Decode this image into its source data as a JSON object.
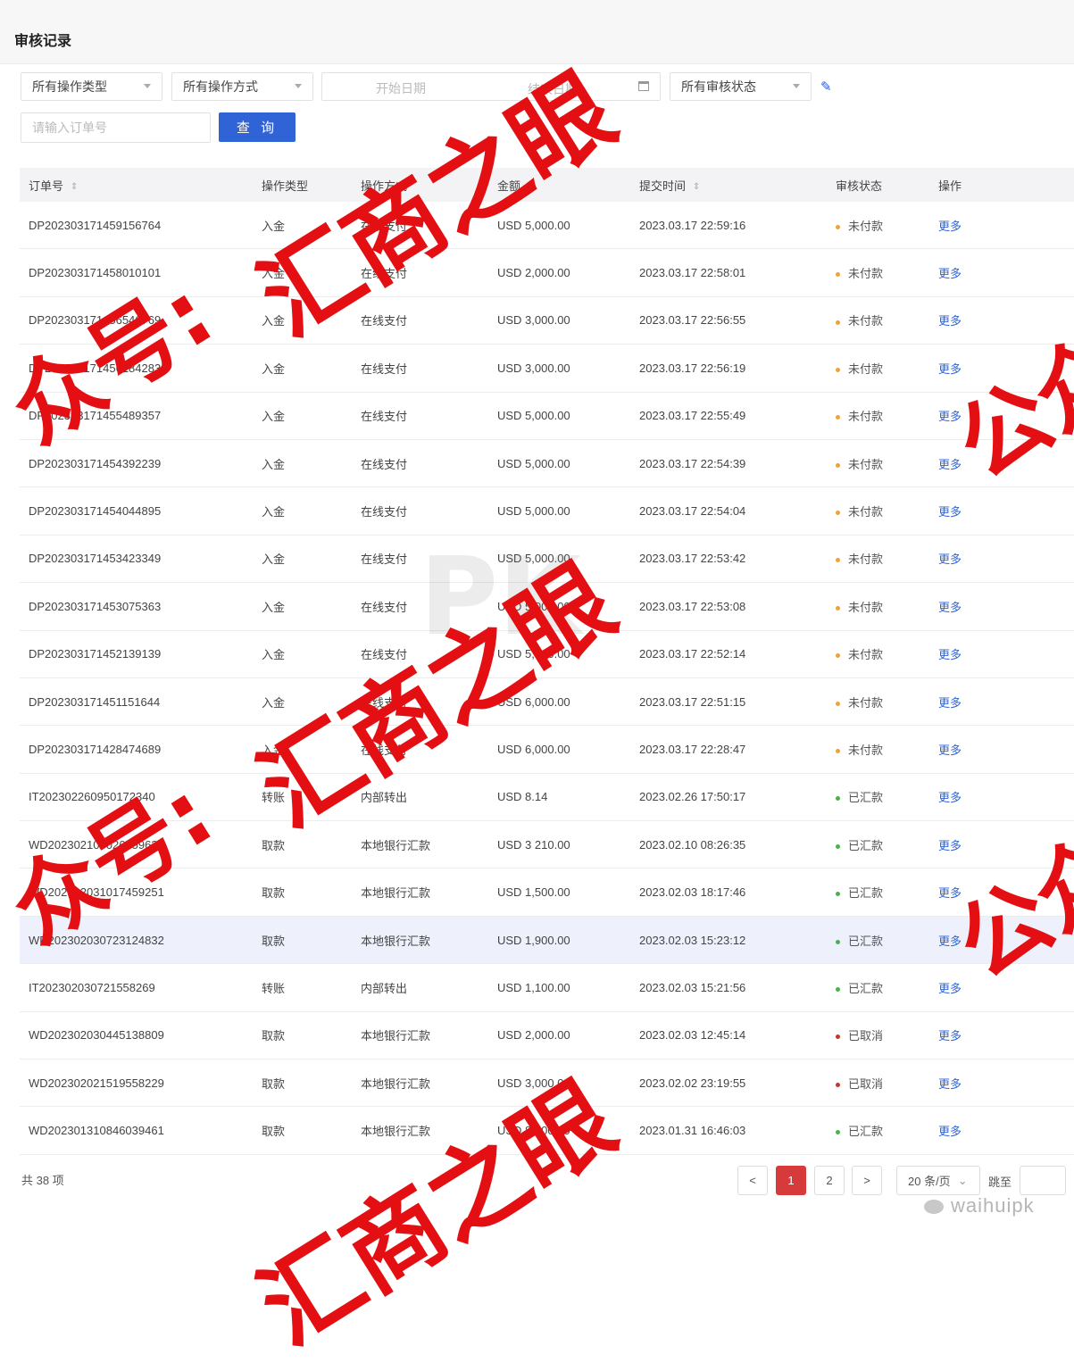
{
  "page": {
    "title": "审核记录"
  },
  "filters": {
    "op_type": "所有操作类型",
    "op_method": "所有操作方式",
    "start_date": "开始日期",
    "end_date": "结束日期",
    "status": "所有审核状态",
    "order_placeholder": "请输入订单号",
    "query_label": "查 询"
  },
  "table": {
    "headers": [
      "订单号",
      "操作类型",
      "操作方式",
      "金额",
      "提交时间",
      "审核状态",
      "操作"
    ],
    "rows": [
      {
        "order": "DP202303171459156764",
        "type": "入金",
        "method": "在线支付",
        "amount": "USD 5,000.00",
        "time": "2023.03.17 22:59:16",
        "status": "未付款",
        "action": "更多"
      },
      {
        "order": "DP202303171458010101",
        "type": "入金",
        "method": "在线支付",
        "amount": "USD 2,000.00",
        "time": "2023.03.17 22:58:01",
        "status": "未付款",
        "action": "更多"
      },
      {
        "order": "DP202303171456546769",
        "type": "入金",
        "method": "在线支付",
        "amount": "USD 3,000.00",
        "time": "2023.03.17 22:56:55",
        "status": "未付款",
        "action": "更多"
      },
      {
        "order": "DP202303171456184283",
        "type": "入金",
        "method": "在线支付",
        "amount": "USD 3,000.00",
        "time": "2023.03.17 22:56:19",
        "status": "未付款",
        "action": "更多"
      },
      {
        "order": "DP202303171455489357",
        "type": "入金",
        "method": "在线支付",
        "amount": "USD 5,000.00",
        "time": "2023.03.17 22:55:49",
        "status": "未付款",
        "action": "更多"
      },
      {
        "order": "DP202303171454392239",
        "type": "入金",
        "method": "在线支付",
        "amount": "USD 5,000.00",
        "time": "2023.03.17 22:54:39",
        "status": "未付款",
        "action": "更多"
      },
      {
        "order": "DP202303171454044895",
        "type": "入金",
        "method": "在线支付",
        "amount": "USD 5,000.00",
        "time": "2023.03.17 22:54:04",
        "status": "未付款",
        "action": "更多"
      },
      {
        "order": "DP202303171453423349",
        "type": "入金",
        "method": "在线支付",
        "amount": "USD 5,000.00",
        "time": "2023.03.17 22:53:42",
        "status": "未付款",
        "action": "更多"
      },
      {
        "order": "DP202303171453075363",
        "type": "入金",
        "method": "在线支付",
        "amount": "USD 5,000.00",
        "time": "2023.03.17 22:53:08",
        "status": "未付款",
        "action": "更多"
      },
      {
        "order": "DP202303171452139139",
        "type": "入金",
        "method": "在线支付",
        "amount": "USD 5,000.00",
        "time": "2023.03.17 22:52:14",
        "status": "未付款",
        "action": "更多"
      },
      {
        "order": "DP202303171451151644",
        "type": "入金",
        "method": "在线支付",
        "amount": "USD 6,000.00",
        "time": "2023.03.17 22:51:15",
        "status": "未付款",
        "action": "更多"
      },
      {
        "order": "DP202303171428474689",
        "type": "入金",
        "method": "在线支付",
        "amount": "USD 6,000.00",
        "time": "2023.03.17 22:28:47",
        "status": "未付款",
        "action": "更多"
      },
      {
        "order": "IT202302260950172340",
        "type": "转账",
        "method": "内部转出",
        "amount": "USD 8.14",
        "time": "2023.02.26 17:50:17",
        "status": "已汇款",
        "action": "更多"
      },
      {
        "order": "WD202302100026359635",
        "type": "取款",
        "method": "本地银行汇款",
        "amount": "USD 3 210.00",
        "time": "2023.02.10 08:26:35",
        "status": "已汇款",
        "action": "更多"
      },
      {
        "order": "WD202302031017459251",
        "type": "取款",
        "method": "本地银行汇款",
        "amount": "USD 1,500.00",
        "time": "2023.02.03 18:17:46",
        "status": "已汇款",
        "action": "更多"
      },
      {
        "order": "WD202302030723124832",
        "type": "取款",
        "method": "本地银行汇款",
        "amount": "USD 1,900.00",
        "time": "2023.02.03 15:23:12",
        "status": "已汇款",
        "action": "更多"
      },
      {
        "order": "IT202302030721558269",
        "type": "转账",
        "method": "内部转出",
        "amount": "USD 1,100.00",
        "time": "2023.02.03 15:21:56",
        "status": "已汇款",
        "action": "更多"
      },
      {
        "order": "WD202302030445138809",
        "type": "取款",
        "method": "本地银行汇款",
        "amount": "USD 2,000.00",
        "time": "2023.02.03 12:45:14",
        "status": "已取消",
        "action": "更多"
      },
      {
        "order": "WD202302021519558229",
        "type": "取款",
        "method": "本地银行汇款",
        "amount": "USD 3,000.00",
        "time": "2023.02.02 23:19:55",
        "status": "已取消",
        "action": "更多"
      },
      {
        "order": "WD202301310846039461",
        "type": "取款",
        "method": "本地银行汇款",
        "amount": "USD 8,000.00",
        "time": "2023.01.31 16:46:03",
        "status": "已汇款",
        "action": "更多"
      }
    ]
  },
  "status_colors": {
    "未付款": "#f0a23a",
    "已汇款": "#4caf50",
    "已取消": "#c0392b"
  },
  "pagination": {
    "total": "共 38 项",
    "prev": "<",
    "pages": [
      "1",
      "2"
    ],
    "current": "1",
    "next": ">",
    "page_size": "20 条/页",
    "jump_label": "跳至"
  },
  "watermarks": {
    "text_main": "汇商之眼",
    "text_side": "众号:",
    "text_right": "公众",
    "logo_text": "PK",
    "brand": "waihuipk"
  }
}
